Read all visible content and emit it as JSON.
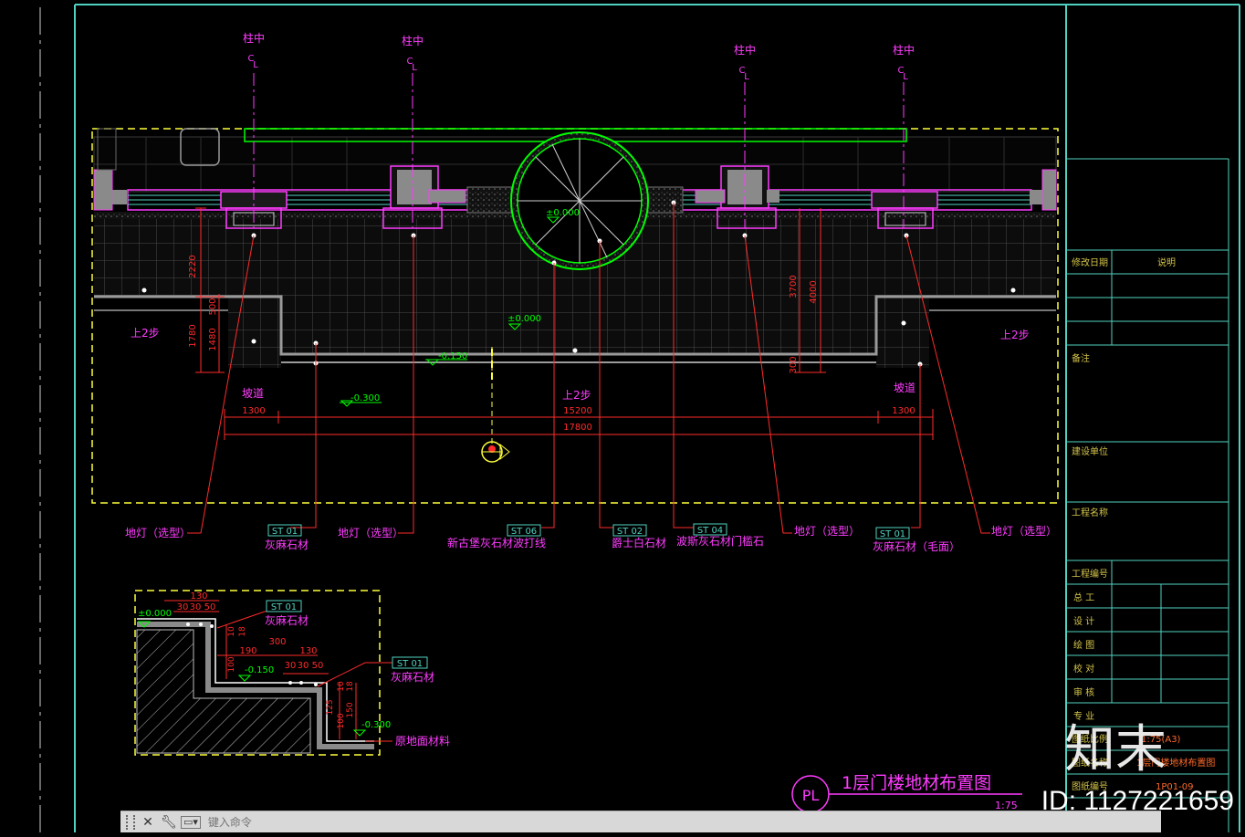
{
  "title": {
    "main": "1层门楼地材布置图",
    "scale": "1:75",
    "badge": "PL"
  },
  "axis_labels": [
    "柱中",
    "柱中",
    "柱中",
    "柱中"
  ],
  "axis_symbol": "C\nL",
  "levels": {
    "l0": "±0.000",
    "l0b": "±0.000",
    "l150": "-0.150",
    "l300": "-0.300"
  },
  "dims": {
    "d2220": "2220",
    "d500": "500",
    "d1780": "1780",
    "d1480": "1480",
    "d3700": "3700",
    "d4000": "4000",
    "d300": "300",
    "d1300a": "1300",
    "d15200": "15200",
    "d1300b": "1300",
    "d17800": "17800"
  },
  "labels": {
    "up_left": "上2步",
    "up_right": "上2步",
    "up_mid": "上2步",
    "ramp_left": "坡道",
    "ramp_right": "坡道"
  },
  "callouts": [
    {
      "code": "",
      "text": "地灯（选型）"
    },
    {
      "code": "ST 01",
      "text": "灰麻石材"
    },
    {
      "code": "",
      "text": "地灯（选型）"
    },
    {
      "code": "ST 06",
      "text": "新古堡灰石材波打线"
    },
    {
      "code": "ST 02",
      "text": "爵士白石材"
    },
    {
      "code": "ST 04",
      "text": "波斯灰石材门槛石"
    },
    {
      "code": "",
      "text": "地灯（选型）"
    },
    {
      "code": "ST 01",
      "text": "灰麻石材（毛面）"
    },
    {
      "code": "",
      "text": "地灯（选型）"
    }
  ],
  "detail": {
    "top_dims": [
      "130",
      "30",
      "30",
      "50"
    ],
    "v_dims": [
      "10",
      "18"
    ],
    "mid_dims": [
      "190",
      "300",
      "130"
    ],
    "bottom_dims": [
      "30",
      "30",
      "50"
    ],
    "side_dims": [
      "100",
      "150",
      "125",
      "100",
      "10",
      "18"
    ],
    "level_top": "±0.000",
    "level_mid": "-0.150",
    "level_bot": "-0.300",
    "code1": "ST 01",
    "text1": "灰麻石材",
    "code2": "ST 01",
    "text2": "灰麻石材",
    "text3": "原地面材料"
  },
  "title_block": {
    "rev_date": "修改日期",
    "note": "说明",
    "remarks": "备注",
    "client": "建设单位",
    "project": "工程名称",
    "project_no": "工程编号",
    "roles": [
      "总 工",
      "设 计",
      "绘 图",
      "校 对",
      "审 核",
      "专 业"
    ],
    "scale_label": "图纸比例",
    "scale_value": "1:75(A3)",
    "drawing_name_label": "图纸名称",
    "drawing_name": "1层门楼地材布置图",
    "drawing_no_label": "图纸编号",
    "drawing_no": "1P01-09"
  },
  "watermark": {
    "logo": "知末",
    "id": "ID: 1127221659"
  },
  "command": {
    "placeholder": "键入命令"
  },
  "colors": {
    "bg": "#000000",
    "dim": "#ff2a2a",
    "label": "#ff3cff",
    "frame": "#4fd2c0",
    "plan": "#00ff00",
    "hatch": "#6a6a6a",
    "yellow": "#ffff3a"
  }
}
